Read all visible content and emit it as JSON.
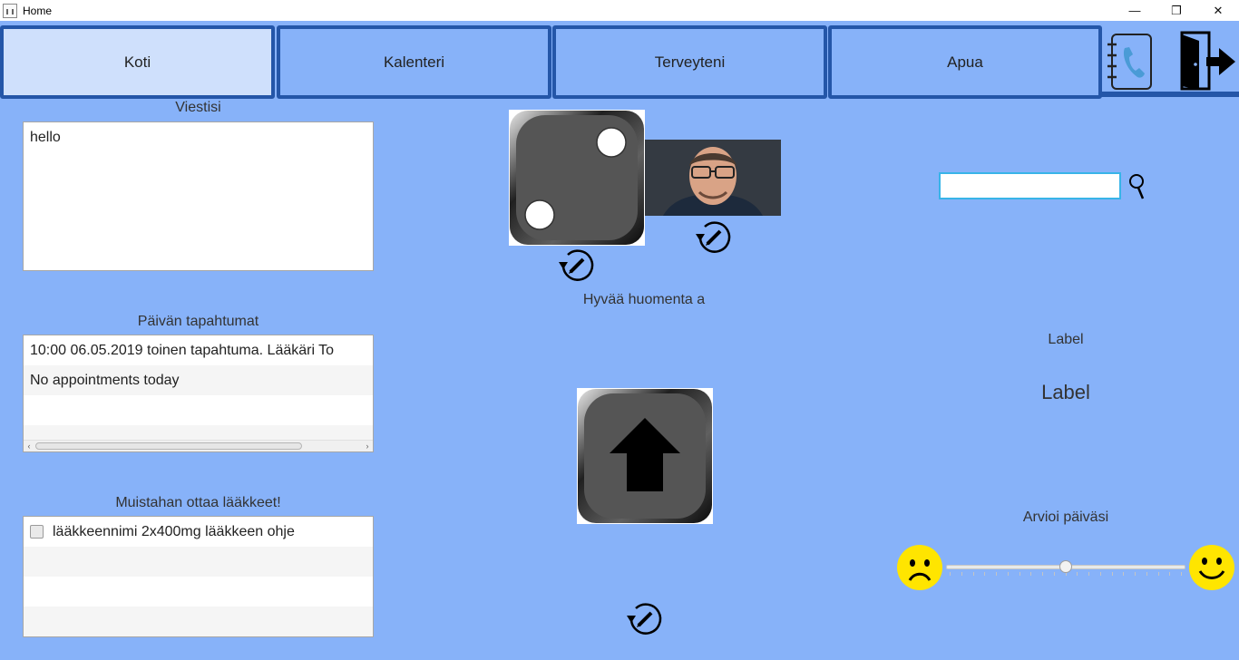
{
  "window": {
    "title": "Home",
    "minimize_glyph": "—",
    "restore_glyph": "❐",
    "close_glyph": "✕"
  },
  "tabs": [
    {
      "label": "Koti",
      "active": true
    },
    {
      "label": "Kalenteri",
      "active": false
    },
    {
      "label": "Terveyteni",
      "active": false
    },
    {
      "label": "Apua",
      "active": false
    }
  ],
  "toolbar_icons": [
    "phonebook-icon",
    "exit-door-icon"
  ],
  "messages": {
    "title": "Viestisi",
    "text": "hello"
  },
  "events": {
    "title": "Päivän tapahtumat",
    "rows": [
      "10:00  06.05.2019  toinen tapahtuma. Lääkäri To",
      "No appointments today",
      "",
      ""
    ],
    "scroll_left": "‹",
    "scroll_right": "›"
  },
  "medicine": {
    "title": "Muistahan ottaa lääkkeet!",
    "items": [
      {
        "label": "lääkkeennimi 2x400mg lääkkeen ohje",
        "checked": false
      },
      {
        "label": "",
        "checked": false
      },
      {
        "label": "",
        "checked": false
      },
      {
        "label": "",
        "checked": false
      }
    ]
  },
  "center": {
    "greeting": "Hyvää huomenta a",
    "dice_value": 2
  },
  "search": {
    "value": "",
    "placeholder": ""
  },
  "labels": {
    "small": "Label",
    "large": "Label"
  },
  "rating": {
    "title": "Arvioi päiväsi",
    "value": 0.5
  },
  "colors": {
    "background": "#87b2f9",
    "tab_border": "#2456a8",
    "tab_active": "#cfe0fc",
    "search_border": "#38b4e8",
    "smiley": "#ffe500"
  }
}
